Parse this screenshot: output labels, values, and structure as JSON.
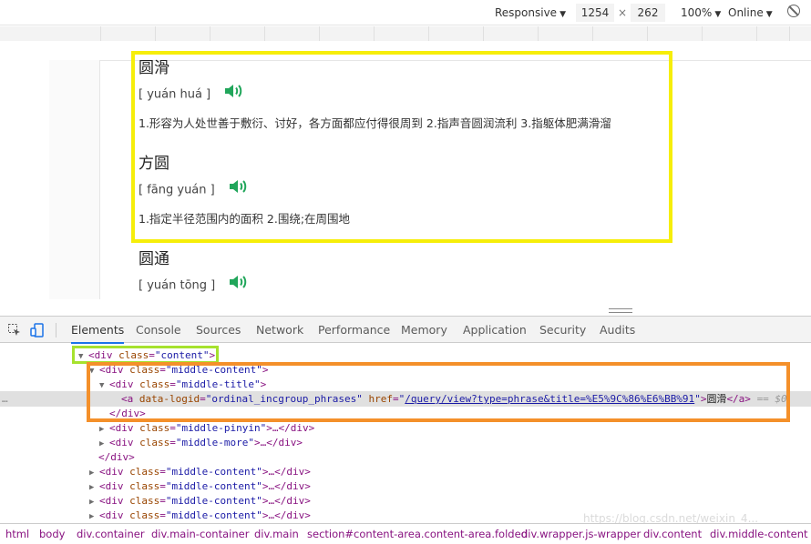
{
  "device_toolbar": {
    "mode": "Responsive",
    "width": "1254",
    "times": "×",
    "height": "262",
    "zoom": "100%",
    "network": "Online"
  },
  "words": [
    {
      "title": "圆滑",
      "pinyin": "[ yuán huá ]",
      "definition": "1.形容为人处世善于敷衍、讨好，各方面都应付得很周到 2.指声音圆润流利 3.指躯体肥满滑溜"
    },
    {
      "title": "方圆",
      "pinyin": "[ fāng yuán ]",
      "definition": "1.指定半径范围内的面积 2.围绕;在周围地"
    },
    {
      "title": "圆通",
      "pinyin": "[ yuán tōng ]",
      "definition": ""
    }
  ],
  "devtools": {
    "tabs": [
      "Elements",
      "Console",
      "Sources",
      "Network",
      "Performance",
      "Memory",
      "Application",
      "Security",
      "Audits"
    ],
    "active_tab": "Elements"
  },
  "tree": {
    "l0": {
      "tag_open": "<div",
      "attr": "class",
      "eq": "=",
      "val": "\"content\"",
      "tag_close": ">"
    },
    "l1": {
      "tag_open": "<div",
      "attr": "class",
      "eq": "=",
      "val": "\"middle-content\"",
      "tag_close": ">"
    },
    "l2": {
      "tag_open": "<div",
      "attr": "class",
      "eq": "=",
      "val": "\"middle-title\"",
      "tag_close": ">"
    },
    "l3": {
      "tag_open": "<a",
      "attr1": "data-logid",
      "val1": "\"ordinal_incgroup_phrases\"",
      "attr2": "href",
      "val2": "/query/view?type=phrase&title=%E5%9C%86%E6%BB%91",
      "quote": "\"",
      "tag_close": ">",
      "text": "圆滑",
      "end_tag": "</a>",
      "console_ref": "== $0"
    },
    "l4": {
      "text": "</div>"
    },
    "l5": {
      "tag_open": "<div",
      "attr": "class",
      "eq": "=",
      "val": "\"middle-pinyin\"",
      "rest": ">…</div>"
    },
    "l6": {
      "tag_open": "<div",
      "attr": "class",
      "eq": "=",
      "val": "\"middle-more\"",
      "rest": ">…</div>"
    },
    "l7": {
      "text": "</div>"
    },
    "l8": {
      "tag_open": "<div",
      "attr": "class",
      "eq": "=",
      "val": "\"middle-content\"",
      "rest": ">…</div>"
    },
    "l9": {
      "tag_open": "<div",
      "attr": "class",
      "eq": "=",
      "val": "\"middle-content\"",
      "rest": ">…</div>"
    },
    "l10": {
      "tag_open": "<div",
      "attr": "class",
      "eq": "=",
      "val": "\"middle-content\"",
      "rest": ">…</div>"
    },
    "l11": {
      "tag_open": "<div",
      "attr": "class",
      "eq": "=",
      "val": "\"middle-content\"",
      "rest": ">…</div>"
    },
    "ellipsis": "…"
  },
  "breadcrumbs": [
    "html",
    "body",
    "div.container",
    "div.main-container",
    "div.main",
    "section#content-area.content-area.folded",
    "div.wrapper.js-wrapper",
    "div.content",
    "div.middle-content"
  ],
  "watermark": "https://blog.csdn.net/weixin_4..."
}
